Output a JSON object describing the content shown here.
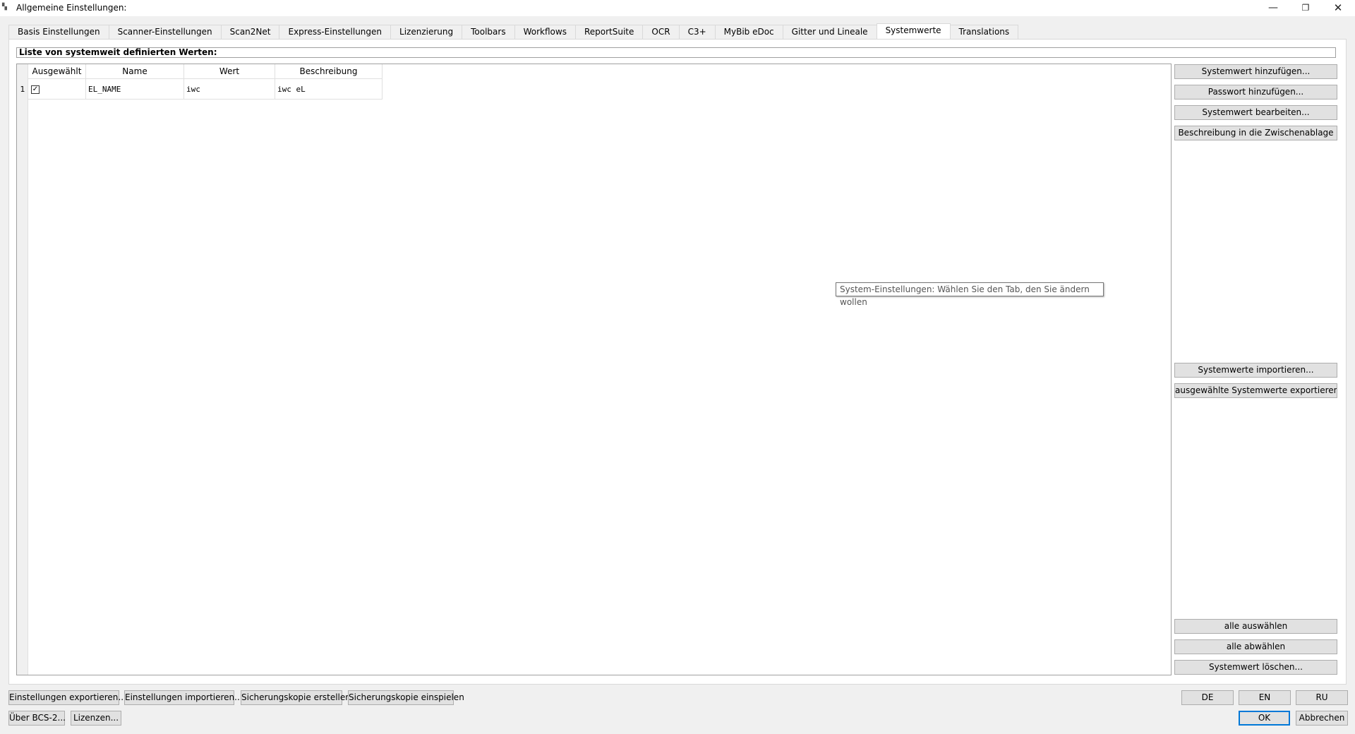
{
  "window": {
    "title": "Allgemeine Einstellungen:",
    "app_icon": "app-icon",
    "min_glyph": "—",
    "max_glyph": "❐",
    "close_glyph": "✕"
  },
  "tabs": [
    {
      "label": "Basis Einstellungen"
    },
    {
      "label": "Scanner-Einstellungen"
    },
    {
      "label": "Scan2Net"
    },
    {
      "label": "Express-Einstellungen"
    },
    {
      "label": "Lizenzierung"
    },
    {
      "label": "Toolbars"
    },
    {
      "label": "Workflows"
    },
    {
      "label": "ReportSuite"
    },
    {
      "label": "OCR"
    },
    {
      "label": "C3+"
    },
    {
      "label": "MyBib eDoc"
    },
    {
      "label": "Gitter und Lineale"
    },
    {
      "label": "Systemwerte",
      "active": true
    },
    {
      "label": "Translations"
    }
  ],
  "list_heading": "Liste von systemweit definierten Werten:",
  "table": {
    "columns": [
      "Ausgewählt",
      "Name",
      "Wert",
      "Beschreibung"
    ],
    "rows": [
      {
        "index": "1",
        "selected": true,
        "check_glyph": "✓",
        "name": "EL_NAME",
        "value": "iwc",
        "description": "iwc eL"
      }
    ]
  },
  "side_buttons": {
    "add": "Systemwert hinzufügen...",
    "add_password": "Passwort hinzufügen...",
    "edit": "Systemwert bearbeiten...",
    "copy_description": "Beschreibung in die Zwischenablage",
    "import": "Systemwerte importieren...",
    "export_selected": "ausgewählte Systemwerte exportieren...",
    "select_all": "alle auswählen",
    "deselect_all": "alle abwählen",
    "delete": "Systemwert löschen..."
  },
  "tooltip": "System-Einstellungen: Wählen Sie den Tab, den Sie ändern wollen",
  "bottom_buttons": {
    "export_settings": "Einstellungen exportieren...",
    "import_settings": "Einstellungen importieren...",
    "create_backup": "Sicherungskopie erstellen",
    "restore_backup": "Sicherungskopie einspielen",
    "about": "Über BCS-2...",
    "licenses": "Lizenzen...",
    "lang_de": "DE",
    "lang_en": "EN",
    "lang_ru": "RU",
    "ok": "OK",
    "cancel": "Abbrechen"
  },
  "colors": {
    "background": "#f0f0f0",
    "button": "#e1e1e1",
    "focus_border": "#0078d7"
  }
}
